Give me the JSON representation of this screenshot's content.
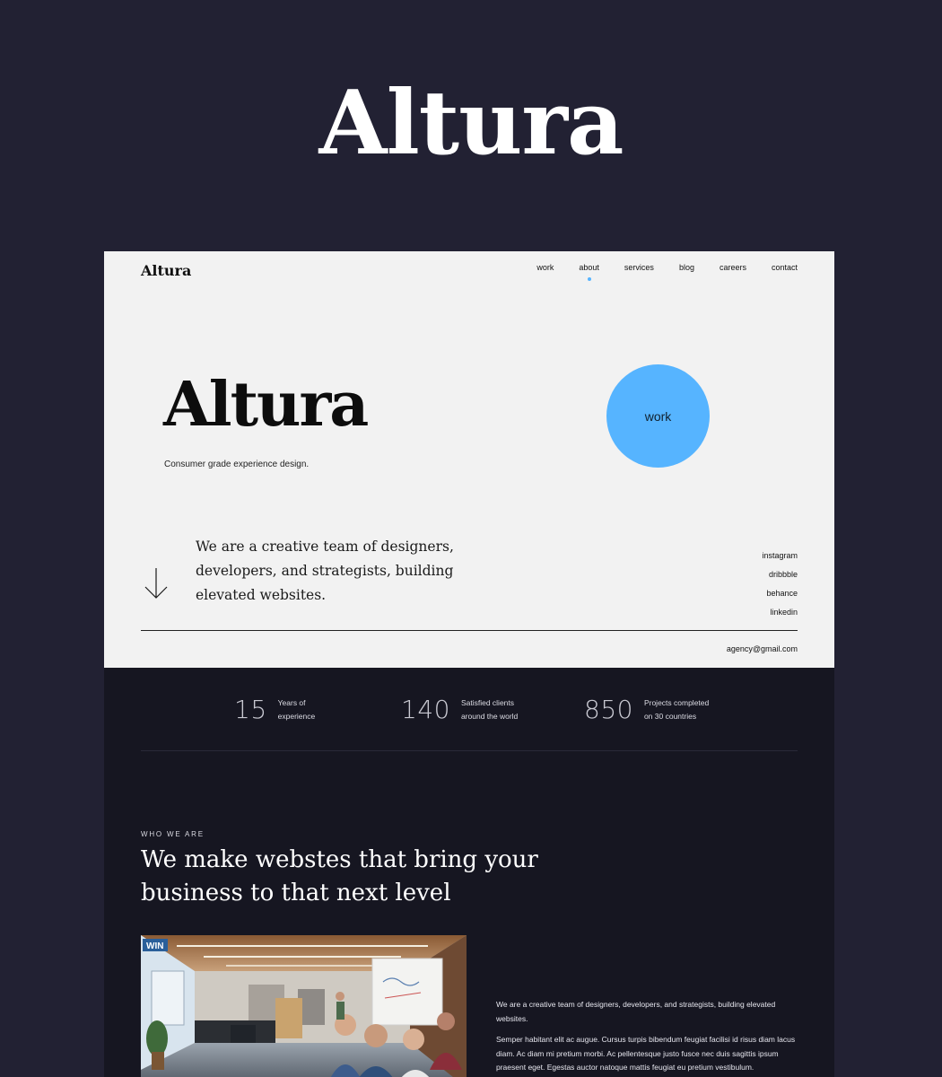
{
  "showcase": {
    "title": "Altura"
  },
  "site": {
    "brand": "Altura",
    "nav": [
      "work",
      "about",
      "services",
      "blog",
      "careers",
      "contact"
    ],
    "nav_active": "about"
  },
  "hero": {
    "title": "Altura",
    "tagline": "Consumer grade experience design.",
    "circle_label": "work",
    "intro": "We are a creative team of designers, developers, and strategists, building elevated websites.",
    "socials": [
      "instagram",
      "dribbble",
      "behance",
      "linkedin"
    ],
    "email": "agency@gmail.com"
  },
  "stats": [
    {
      "number": "15",
      "label_line1": "Years of",
      "label_line2": "experience"
    },
    {
      "number": "140",
      "label_line1": "Satisfied clients",
      "label_line2": "around the world"
    },
    {
      "number": "850",
      "label_line1": "Projects completed",
      "label_line2": "on 30 countries"
    }
  ],
  "about": {
    "eyebrow": "WHO WE ARE",
    "heading": "We make webstes that bring your business to that next level",
    "paragraph1": "We are a creative team of designers, developers, and strategists, building elevated websites.",
    "paragraph2": "Semper habitant elit ac augue. Cursus turpis bibendum feugiat facilisi id risus diam lacus diam. Ac diam mi pretium morbi. Ac pellentesque justo fusce nec duis sagittis ipsum praesent eget. Egestas auctor natoque mattis feugiat eu pretium vestibulum.",
    "photo_sign": "WIN"
  },
  "colors": {
    "page_bg": "#222133",
    "hero_bg": "#f2f2f2",
    "dark_bg": "#161621",
    "accent": "#56b4ff"
  }
}
